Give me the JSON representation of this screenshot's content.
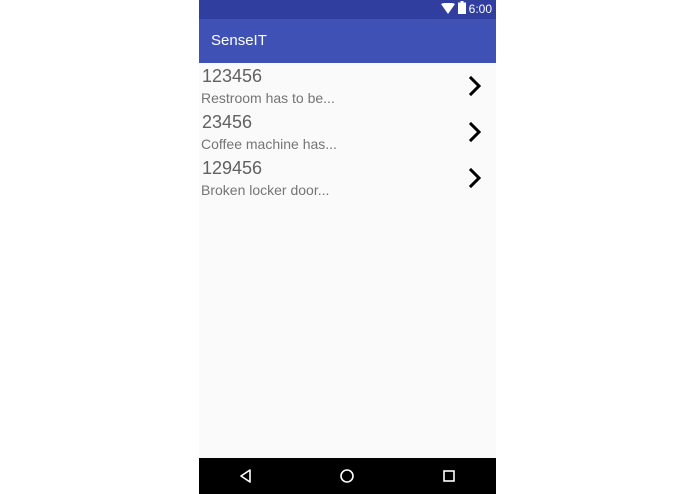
{
  "status_bar": {
    "time": "6:00",
    "icons": [
      "wifi-icon",
      "battery-icon"
    ]
  },
  "app_bar": {
    "title": "SenseIT"
  },
  "list": {
    "items": [
      {
        "id": "123456",
        "description": "Restroom has to be..."
      },
      {
        "id": "23456",
        "description": "Coffee machine has..."
      },
      {
        "id": "129456",
        "description": "Broken locker door..."
      }
    ]
  },
  "nav_bar": {
    "buttons": [
      "back-icon",
      "home-icon",
      "recents-icon"
    ]
  },
  "colors": {
    "status_bar": "#303f9f",
    "app_bar": "#3f51b5",
    "background": "#fafafa",
    "nav_bar": "#000000"
  }
}
